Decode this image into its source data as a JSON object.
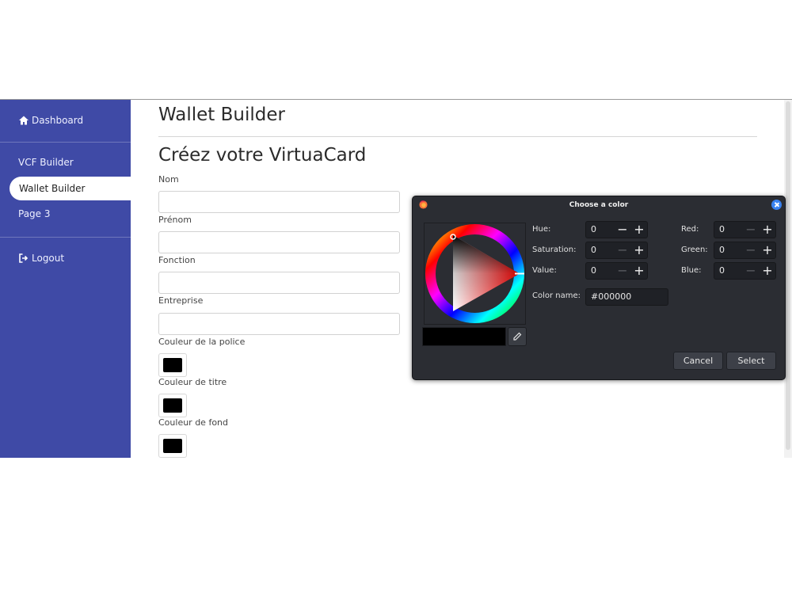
{
  "sidebar": {
    "items": [
      {
        "label": "Dashboard",
        "icon": "home-icon"
      },
      {
        "label": "VCF Builder"
      },
      {
        "label": "Wallet Builder",
        "active": true
      },
      {
        "label": "Page 3"
      },
      {
        "label": "Logout",
        "icon": "logout-icon"
      }
    ],
    "bg_color": "#3f4aa6"
  },
  "main": {
    "title": "Wallet Builder",
    "subtitle": "Créez votre VirtuaCard",
    "fields": [
      {
        "label": "Nom",
        "value": ""
      },
      {
        "label": "Prénom",
        "value": ""
      },
      {
        "label": "Fonction",
        "value": ""
      },
      {
        "label": "Entreprise",
        "value": ""
      }
    ],
    "colors": [
      {
        "label": "Couleur de la police",
        "value": "#000000"
      },
      {
        "label": "Couleur de titre",
        "value": "#000000"
      },
      {
        "label": "Couleur de fond",
        "value": "#000000"
      }
    ]
  },
  "dialog": {
    "title": "Choose a color",
    "hsv": [
      {
        "label": "Hue:",
        "value": "0"
      },
      {
        "label": "Saturation:",
        "value": "0"
      },
      {
        "label": "Value:",
        "value": "0"
      }
    ],
    "rgb": [
      {
        "label": "Red:",
        "value": "0"
      },
      {
        "label": "Green:",
        "value": "0"
      },
      {
        "label": "Blue:",
        "value": "0"
      }
    ],
    "color_name_label": "Color name:",
    "color_name_value": "#000000",
    "minus": "−",
    "plus": "+",
    "cancel_label": "Cancel",
    "select_label": "Select"
  }
}
